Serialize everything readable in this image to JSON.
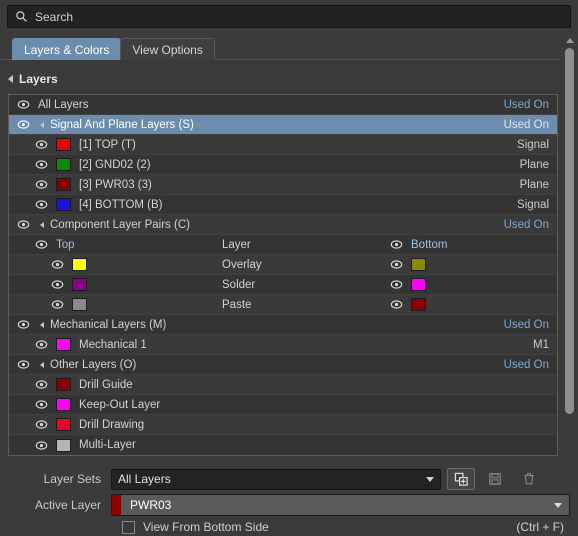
{
  "search": {
    "placeholder": "Search",
    "icon": "search-icon"
  },
  "tabs": [
    {
      "label": "Layers & Colors",
      "active": true
    },
    {
      "label": "View Options",
      "active": false
    }
  ],
  "section": {
    "title": "Layers"
  },
  "columns": {
    "top": "Top",
    "layer": "Layer",
    "bottom": "Bottom"
  },
  "status": {
    "used_on": "Used On",
    "signal": "Signal",
    "plane": "Plane",
    "m1": "M1"
  },
  "layers": {
    "all_layers": "All Layers",
    "signal_group": "Signal And Plane Layers (S)",
    "signal_items": [
      {
        "label": "[1] TOP (T)",
        "color": "#ee0000",
        "type": "Signal"
      },
      {
        "label": "[2] GND02 (2)",
        "color": "#0a8a0a",
        "type": "Plane"
      },
      {
        "label": "[3] PWR03 (3)",
        "color": "#8b0000",
        "type": "Plane"
      },
      {
        "label": "[4] BOTTOM (B)",
        "color": "#1414e6",
        "type": "Signal"
      }
    ],
    "component_group": "Component Layer Pairs (C)",
    "pairs": [
      {
        "label": "Overlay",
        "top_color": "#ffff00",
        "bottom_color": "#8a8a00"
      },
      {
        "label": "Solder",
        "top_color": "#8a008a",
        "bottom_color": "#ff00ff"
      },
      {
        "label": "Paste",
        "top_color": "#8a8a8a",
        "bottom_color": "#8b0000"
      }
    ],
    "mechanical_group": "Mechanical Layers (M)",
    "mechanical_items": [
      {
        "label": "Mechanical 1",
        "color": "#ff00ff",
        "type": "M1"
      }
    ],
    "other_group": "Other Layers (O)",
    "other_items": [
      {
        "label": "Drill Guide",
        "color": "#8b0000"
      },
      {
        "label": "Keep-Out Layer",
        "color": "#ff00ff"
      },
      {
        "label": "Drill Drawing",
        "color": "#f00030"
      },
      {
        "label": "Multi-Layer",
        "color": "#b4b4b4"
      }
    ]
  },
  "controls": {
    "layer_sets_label": "Layer Sets",
    "layer_sets_value": "All Layers",
    "active_layer_label": "Active Layer",
    "active_layer_value": "PWR03",
    "active_layer_color": "#8b0000",
    "buttons": [
      {
        "name": "add-layer-set-button",
        "enabled": true
      },
      {
        "name": "save-layer-set-button",
        "enabled": false
      },
      {
        "name": "delete-layer-set-button",
        "enabled": false
      }
    ],
    "view_bottom_label": "View From Bottom Side",
    "view_bottom_shortcut": "(Ctrl + F)",
    "view_bottom_checked": false
  },
  "colors": {
    "accent": "#6b8cad",
    "background": "#3b3b3b",
    "list_bg": "#343434"
  }
}
